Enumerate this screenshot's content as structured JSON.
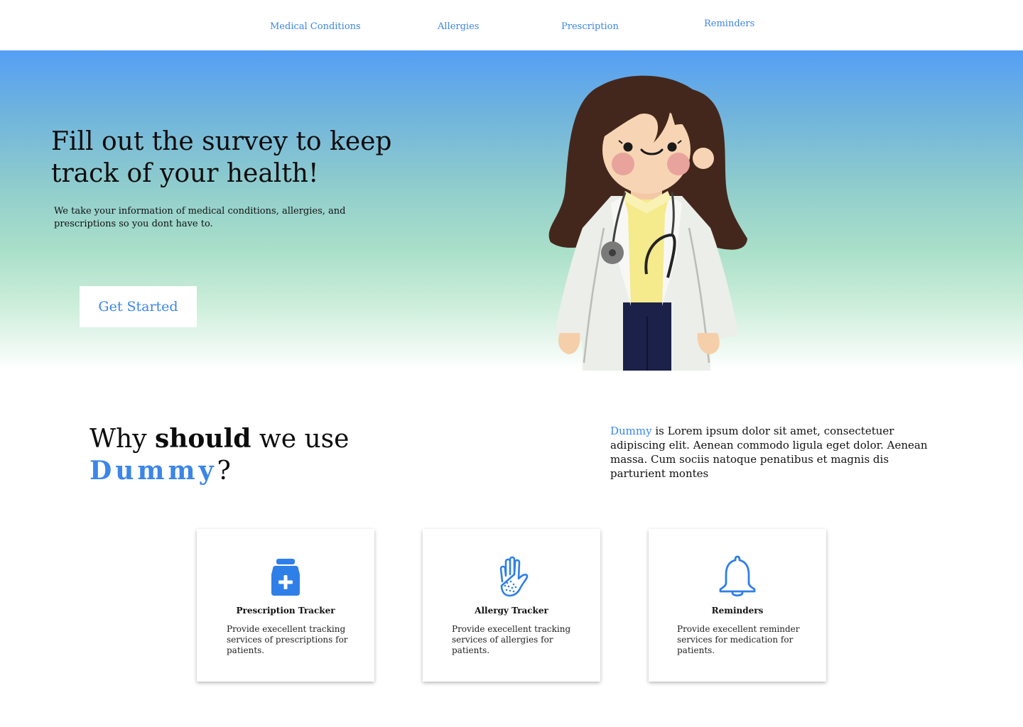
{
  "nav": {
    "items": [
      {
        "label": "Medical Conditions"
      },
      {
        "label": "Allergies"
      },
      {
        "label": "Prescription"
      },
      {
        "label": "Reminders"
      }
    ]
  },
  "hero": {
    "title": "Fill out the survey to keep track of your health!",
    "subtitle": "We take your information of medical conditions, allergies, and prescriptions so you dont have to.",
    "cta_label": "Get Started",
    "illustration": "doctor-illustration"
  },
  "why": {
    "heading_part1": "Why ",
    "heading_bold": "should",
    "heading_part2": " we use",
    "heading_brand": "Dummy",
    "heading_end": "?",
    "desc_brand": "Dummy",
    "desc_text": " is Lorem ipsum dolor sit amet, consectetuer adipiscing elit. Aenean commodo ligula eget dolor. Aenean massa. Cum sociis natoque penatibus et magnis dis parturient montes"
  },
  "features": [
    {
      "icon": "medicine-bottle-icon",
      "title": "Prescription Tracker",
      "text": "Provide execellent tracking services of prescriptions for patients."
    },
    {
      "icon": "allergy-hand-icon",
      "title": "Allergy Tracker",
      "text": "Provide execellent tracking services of allergies for patients."
    },
    {
      "icon": "bell-icon",
      "title": "Reminders",
      "text": "Provide execellent reminder services for medication for patients."
    }
  ],
  "colors": {
    "accent": "#3b86e8",
    "hero_top": "#559ff6",
    "hero_mid": "#a9dfc9"
  }
}
